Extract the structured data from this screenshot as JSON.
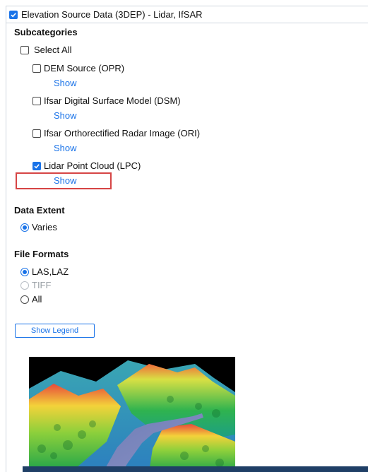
{
  "header": {
    "title": "Elevation Source Data (3DEP) - Lidar, IfSAR",
    "checked": true
  },
  "subcategories": {
    "title": "Subcategories",
    "select_all": "Select All",
    "items": [
      {
        "label": "DEM Source (OPR)",
        "checked": false,
        "show": "Show"
      },
      {
        "label": "Ifsar Digital Surface Model (DSM)",
        "checked": false,
        "show": "Show"
      },
      {
        "label": "Ifsar Orthorectified Radar Image (ORI)",
        "checked": false,
        "show": "Show"
      },
      {
        "label": "Lidar Point Cloud (LPC)",
        "checked": true,
        "show": "Show"
      }
    ]
  },
  "data_extent": {
    "title": "Data Extent",
    "options": [
      {
        "label": "Varies",
        "selected": true
      }
    ]
  },
  "file_formats": {
    "title": "File Formats",
    "options": [
      {
        "label": "LAS,LAZ",
        "selected": true,
        "disabled": false
      },
      {
        "label": "TIFF",
        "selected": false,
        "disabled": true
      },
      {
        "label": "All",
        "selected": false,
        "disabled": false
      }
    ]
  },
  "legend_button": "Show Legend",
  "colors": {
    "accent": "#1a73e8",
    "highlight": "#d64545",
    "border": "#cfd6de",
    "bottom_bar": "#1f3f66"
  }
}
